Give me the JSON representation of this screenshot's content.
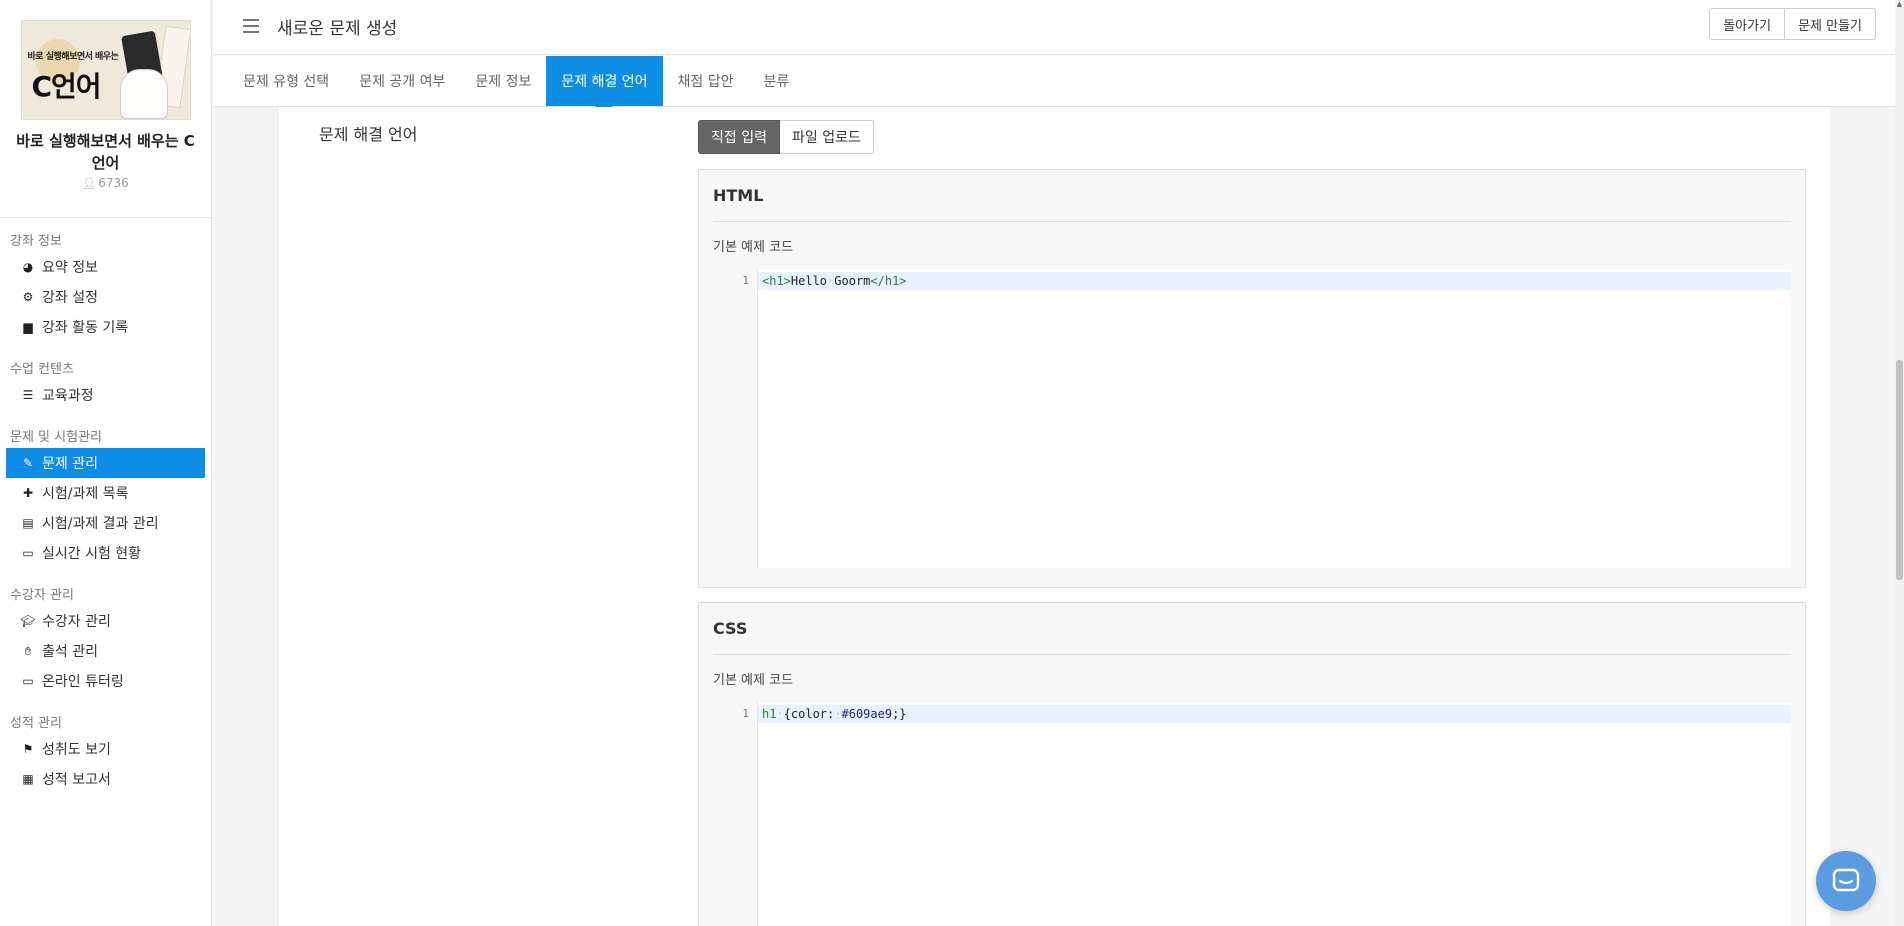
{
  "course": {
    "thumb_subtitle": "바로 실행해보면서 배우는",
    "thumb_main": "C언어",
    "title": "바로 실행해보면서 배우는 C언어",
    "count": "6736"
  },
  "sidebar": {
    "sections": [
      {
        "title": "강좌 정보",
        "items": [
          {
            "label": "요약 정보",
            "icon": "pie-chart-icon"
          },
          {
            "label": "강좌 설정",
            "icon": "gears-icon"
          },
          {
            "label": "강좌 활동 기록",
            "icon": "archive-icon"
          }
        ]
      },
      {
        "title": "수업 컨텐츠",
        "items": [
          {
            "label": "교육과정",
            "icon": "list-icon"
          }
        ]
      },
      {
        "title": "문제 및 시험관리",
        "items": [
          {
            "label": "문제 관리",
            "icon": "edit-icon",
            "active": true
          },
          {
            "label": "시험/과제 목록",
            "icon": "puzzle-icon"
          },
          {
            "label": "시험/과제 결과 관리",
            "icon": "file-text-icon"
          },
          {
            "label": "실시간 시험 현황",
            "icon": "monitor-icon"
          }
        ]
      },
      {
        "title": "수강자 관리",
        "items": [
          {
            "label": "수강자 관리",
            "icon": "graduation-cap-icon"
          },
          {
            "label": "출석 관리",
            "icon": "hand-icon"
          },
          {
            "label": "온라인 튜터링",
            "icon": "monitor-icon"
          }
        ]
      },
      {
        "title": "성적 관리",
        "items": [
          {
            "label": "성취도 보기",
            "icon": "flag-icon"
          },
          {
            "label": "성적 보고서",
            "icon": "calculator-icon"
          }
        ]
      }
    ]
  },
  "header": {
    "title": "새로운 문제 생성",
    "back_label": "돌아가기",
    "create_label": "문제 만들기"
  },
  "tabs": [
    {
      "label": "문제 유형 선택"
    },
    {
      "label": "문제 공개 여부"
    },
    {
      "label": "문제 정보"
    },
    {
      "label": "문제 해결 언어",
      "active": true
    },
    {
      "label": "채점 답안"
    },
    {
      "label": "분류"
    }
  ],
  "main": {
    "section_label": "문제 해결 언어",
    "toggle": {
      "direct": "직접 입력",
      "upload": "파일 업로드"
    },
    "panels": [
      {
        "title": "HTML",
        "subtitle": "기본 예제 코드",
        "line_no": "1"
      },
      {
        "title": "CSS",
        "subtitle": "기본 예제 코드",
        "line_no": "1"
      }
    ],
    "html_code": {
      "open_tag": "<h1>",
      "text1": "Hello",
      "text2": "Goorm",
      "close_tag": "</h1>"
    },
    "css_code": {
      "selector": "h1",
      "brace_open": "{color:",
      "value": "#609ae9",
      "brace_close": ";}"
    }
  },
  "colors": {
    "accent": "#0d8de4",
    "chat": "#5b9bdf"
  }
}
